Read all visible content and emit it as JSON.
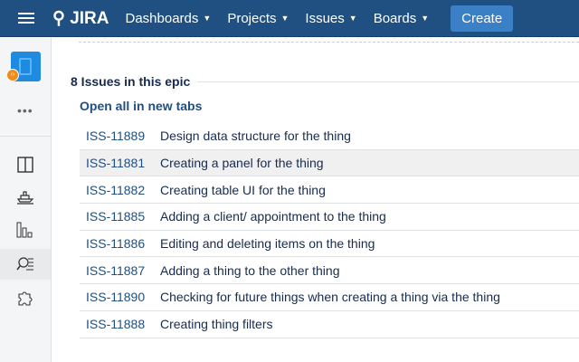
{
  "header": {
    "logo": "JIRA",
    "nav": [
      "Dashboards",
      "Projects",
      "Issues",
      "Boards"
    ],
    "create": "Create"
  },
  "sidebar": {
    "more": "•••"
  },
  "epic": {
    "heading": "8 Issues in this epic",
    "open_all": "Open all in new tabs",
    "issues": [
      {
        "key": "ISS-11889",
        "summary": "Design data structure for the thing"
      },
      {
        "key": "ISS-11881",
        "summary": "Creating a panel for the thing"
      },
      {
        "key": "ISS-11882",
        "summary": "Creating table UI for the thing"
      },
      {
        "key": "ISS-11885",
        "summary": "Adding a client/ appointment to the thing"
      },
      {
        "key": "ISS-11886",
        "summary": "Editing and deleting items on the thing"
      },
      {
        "key": "ISS-11887",
        "summary": "Adding a thing to the other thing"
      },
      {
        "key": "ISS-11890",
        "summary": "Checking for future things when creating a thing via the thing"
      },
      {
        "key": "ISS-11888",
        "summary": "Creating thing filters"
      }
    ]
  }
}
